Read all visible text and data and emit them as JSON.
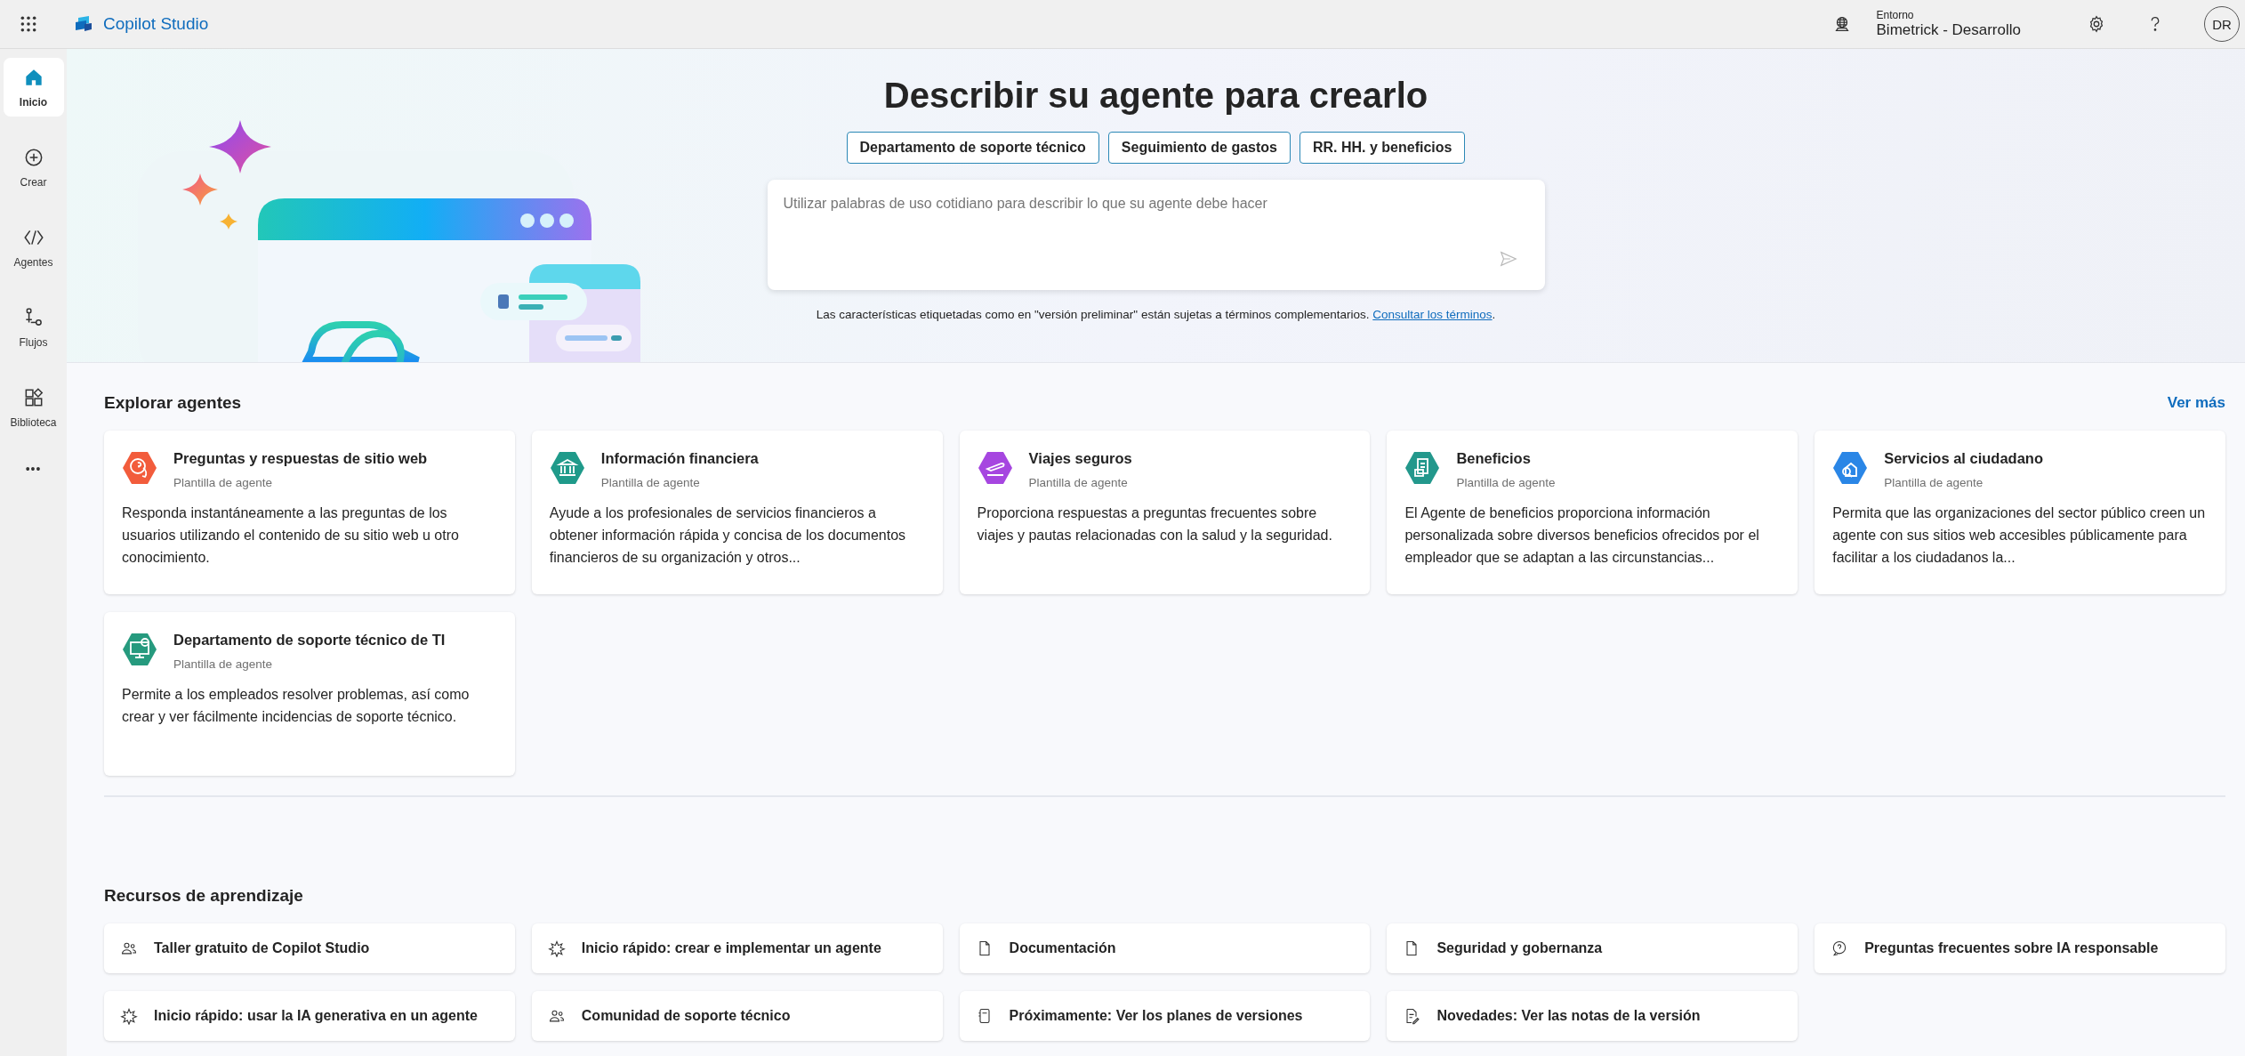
{
  "app": {
    "title": "Copilot Studio"
  },
  "environment": {
    "label": "Entorno",
    "name": "Bimetrick - Desarrollo"
  },
  "user": {
    "initials": "DR"
  },
  "sidebar": {
    "items": [
      {
        "label": "Inicio",
        "selected": true
      },
      {
        "label": "Crear",
        "selected": false
      },
      {
        "label": "Agentes",
        "selected": false
      },
      {
        "label": "Flujos",
        "selected": false
      },
      {
        "label": "Biblioteca",
        "selected": false
      }
    ],
    "more": "•••"
  },
  "hero": {
    "title": "Describir su agente para crearlo",
    "suggestions": [
      "Departamento de soporte técnico",
      "Seguimiento de gastos",
      "RR. HH. y beneficios"
    ],
    "prompt": {
      "placeholder": "Utilizar palabras de uso cotidiano para describir lo que su agente debe hacer"
    },
    "disclaimer": "Las características etiquetadas como en \"versión preliminar\" están sujetas a términos complementarios.",
    "terms_link": "Consultar los términos",
    "terms_end": "."
  },
  "explore": {
    "title": "Explorar agentes",
    "see_more": "Ver más",
    "cards": [
      {
        "title": "Preguntas y respuestas de sitio web",
        "subtitle": "Plantilla de agente",
        "description": "Responda instantáneamente a las preguntas de los usuarios utilizando el contenido de su sitio web u otro conocimiento.",
        "color": "#f25c3c"
      },
      {
        "title": "Información financiera",
        "subtitle": "Plantilla de agente",
        "description": "Ayude a los profesionales de servicios financieros a obtener información rápida y concisa de los documentos financieros de su organización y otros...",
        "color": "#1f9a8a"
      },
      {
        "title": "Viajes seguros",
        "subtitle": "Plantilla de agente",
        "description": "Proporciona respuestas a preguntas frecuentes sobre viajes y pautas relacionadas con la salud y la seguridad.",
        "color": "#a646e0"
      },
      {
        "title": "Beneficios",
        "subtitle": "Plantilla de agente",
        "description": "El Agente de beneficios proporciona información personalizada sobre diversos beneficios ofrecidos por el empleador que se adaptan a las circunstancias...",
        "color": "#23988c"
      },
      {
        "title": "Servicios al ciudadano",
        "subtitle": "Plantilla de agente",
        "description": "Permita que las organizaciones del sector público creen un agente con sus sitios web accesibles públicamente para facilitar a los ciudadanos la...",
        "color": "#2a86e6"
      },
      {
        "title": "Departamento de soporte técnico de TI",
        "subtitle": "Plantilla de agente",
        "description": "Permite a los empleados resolver problemas, así como crear y ver fácilmente incidencias de soporte técnico.",
        "color": "#269a7e"
      }
    ]
  },
  "learning": {
    "title": "Recursos de aprendizaje",
    "items": [
      "Taller gratuito de Copilot Studio",
      "Inicio rápido: crear e implementar un agente",
      "Documentación",
      "Seguridad y gobernanza",
      "Preguntas frecuentes sobre IA responsable",
      "Inicio rápido: usar la IA generativa en un agente",
      "Comunidad de soporte técnico",
      "Próximamente: Ver los planes de versiones",
      "Novedades: Ver las notas de la versión"
    ]
  }
}
